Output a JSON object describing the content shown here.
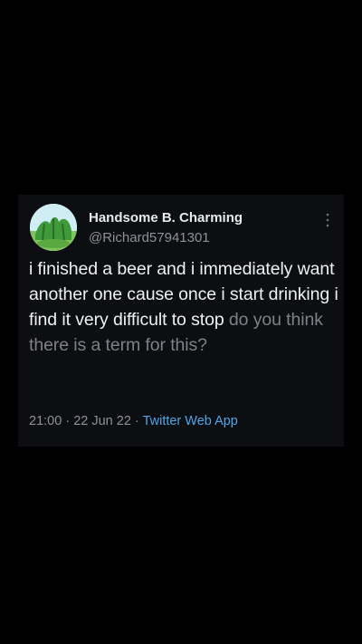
{
  "tweet": {
    "display_name": "Handsome B. Charming",
    "handle": "@Richard57941301",
    "text_bright": "i finished a beer and i immediately want another one cause once i start drinking i find it very difficult to stop",
    "text_dim": "do you think there is a term for this?",
    "time": "21:00",
    "separator": "·",
    "date": "22 Jun 22",
    "source": "Twitter Web App",
    "avatar_icon": "cactus-avatar-icon",
    "more_icon": "more-options-icon"
  },
  "colors": {
    "background": "#000000",
    "card": "#0d0e11",
    "link_blue": "#4fa6e8",
    "muted_text": "#8b9298"
  }
}
